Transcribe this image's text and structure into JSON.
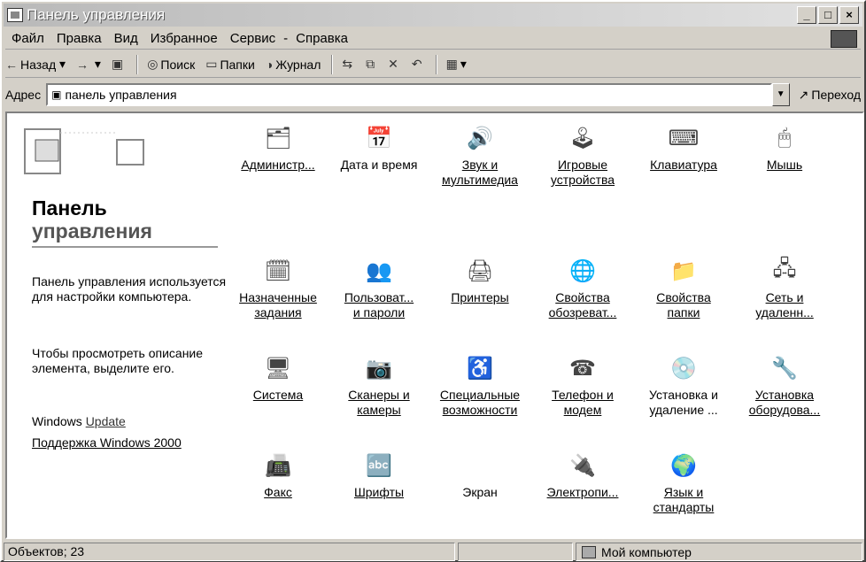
{
  "window": {
    "title": "Панель управления",
    "minimize": "_",
    "maximize": "□",
    "close": "×"
  },
  "menu": [
    "Файл",
    "Правка",
    "Вид",
    "Избранное",
    "Сервис",
    "-",
    "Справка"
  ],
  "toolbar": {
    "back": "Назад",
    "forward_glyph": "→",
    "search": "Поиск",
    "folders": "Папки",
    "history": "Журнал"
  },
  "address": {
    "label": "Адрес",
    "value": "панель управления",
    "go": "Переход"
  },
  "left_pane": {
    "title_line1": "Панель",
    "title_line2": "управления",
    "desc1": "Панель управления используется для настройки компьютера.",
    "desc2": "Чтобы просмотреть описание элемента, выделите его.",
    "link_windows_prefix": "Windows",
    "link_windows_suffix": "Update",
    "link_support": "Поддержка Windows 2000"
  },
  "items": [
    {
      "line1": "Администр...",
      "line2": "",
      "icon": "admin-tools-icon",
      "glyph": "🗂"
    },
    {
      "line1": "Дата и время",
      "line2": "",
      "icon": "calendar-clock-icon",
      "glyph": "📅"
    },
    {
      "line1": "Звук и",
      "line2": "мультимедиа",
      "icon": "sound-icon",
      "glyph": "🔊"
    },
    {
      "line1": "Игровые",
      "line2": "устройства",
      "icon": "joystick-icon",
      "glyph": "🕹"
    },
    {
      "line1": "Клавиатура",
      "line2": "",
      "icon": "keyboard-icon",
      "glyph": "⌨"
    },
    {
      "line1": "Мышь",
      "line2": "",
      "icon": "mouse-icon",
      "glyph": "🖱"
    },
    {
      "line1": "Назначенные",
      "line2": "задания",
      "icon": "scheduled-tasks-icon",
      "glyph": "🗓"
    },
    {
      "line1": "Пользоват...",
      "line2": "и пароли",
      "icon": "users-icon",
      "glyph": "👥"
    },
    {
      "line1": "Принтеры",
      "line2": "",
      "icon": "printers-folder-icon",
      "glyph": "🖨"
    },
    {
      "line1": "Свойства",
      "line2": "обозреват...",
      "icon": "internet-options-icon",
      "glyph": "🌐"
    },
    {
      "line1": "Свойства",
      "line2": "папки",
      "icon": "folder-options-icon",
      "glyph": "📁"
    },
    {
      "line1": "Сеть и",
      "line2": "удаленн...",
      "icon": "network-folder-icon",
      "glyph": "🖧"
    },
    {
      "line1": "Система",
      "line2": "",
      "icon": "computer-icon",
      "glyph": "🖥"
    },
    {
      "line1": "Сканеры и",
      "line2": "камеры",
      "icon": "scanner-camera-icon",
      "glyph": "📷"
    },
    {
      "line1": "Специальные",
      "line2": "возможности",
      "icon": "accessibility-icon",
      "glyph": "♿"
    },
    {
      "line1": "Телефон и",
      "line2": "модем",
      "icon": "phone-modem-icon",
      "glyph": "☎"
    },
    {
      "line1": "Установка и",
      "line2": "удаление ...",
      "icon": "add-remove-programs-icon",
      "glyph": "💿"
    },
    {
      "line1": "Установка",
      "line2": "оборудова...",
      "icon": "add-hardware-icon",
      "glyph": "🔧"
    },
    {
      "line1": "Факс",
      "line2": "",
      "icon": "fax-icon",
      "glyph": "📠"
    },
    {
      "line1": "Шрифты",
      "line2": "",
      "icon": "fonts-folder-icon",
      "glyph": "🔤"
    },
    {
      "line1": "Экран",
      "line2": "",
      "icon": "display-icon",
      "glyph": ""
    },
    {
      "line1": "Электропи...",
      "line2": "",
      "icon": "power-options-icon",
      "glyph": "🔌"
    },
    {
      "line1": "Язык и",
      "line2": "стандарты",
      "icon": "globe-icon",
      "glyph": "🌍"
    }
  ],
  "status": {
    "left": "Объектов; 23",
    "right": "Мой компьютер"
  }
}
